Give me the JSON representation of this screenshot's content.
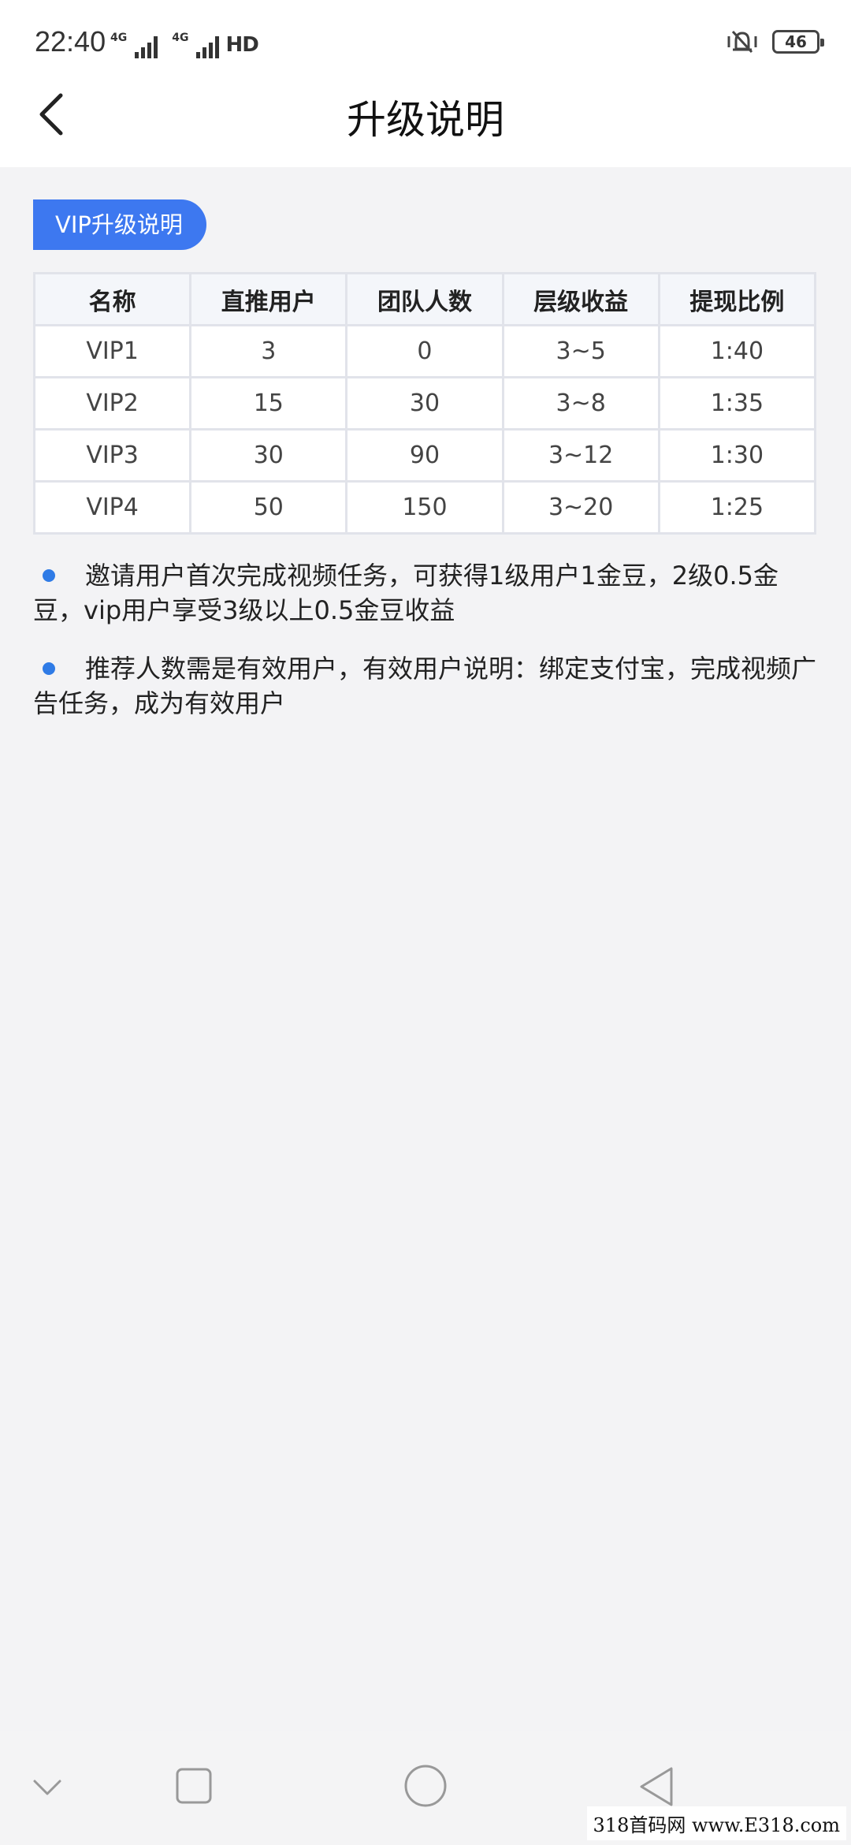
{
  "status": {
    "time": "22:40",
    "net1": "4G",
    "net2": "4G",
    "hd": "HD",
    "battery": "46"
  },
  "header": {
    "title": "升级说明"
  },
  "section": {
    "tag": "VIP升级说明"
  },
  "table": {
    "columns": [
      "名称",
      "直推用户",
      "团队人数",
      "层级收益",
      "提现比例"
    ],
    "rows": [
      [
        "VIP1",
        "3",
        "0",
        "3~5",
        "1:40"
      ],
      [
        "VIP2",
        "15",
        "30",
        "3~8",
        "1:35"
      ],
      [
        "VIP3",
        "30",
        "90",
        "3~12",
        "1:30"
      ],
      [
        "VIP4",
        "50",
        "150",
        "3~20",
        "1:25"
      ]
    ]
  },
  "notes": [
    "邀请用户首次完成视频任务，可获得1级用户1金豆，2级0.5金豆，vip用户享受3级以上0.5金豆收益",
    "推荐人数需是有效用户，有效用户说明：绑定支付宝，完成视频广告任务，成为有效用户"
  ],
  "watermark": "318首码网 www.E318.com",
  "colors": {
    "accent": "#3d78f0",
    "bullet": "#2f7be6",
    "background": "#f3f3f5"
  }
}
